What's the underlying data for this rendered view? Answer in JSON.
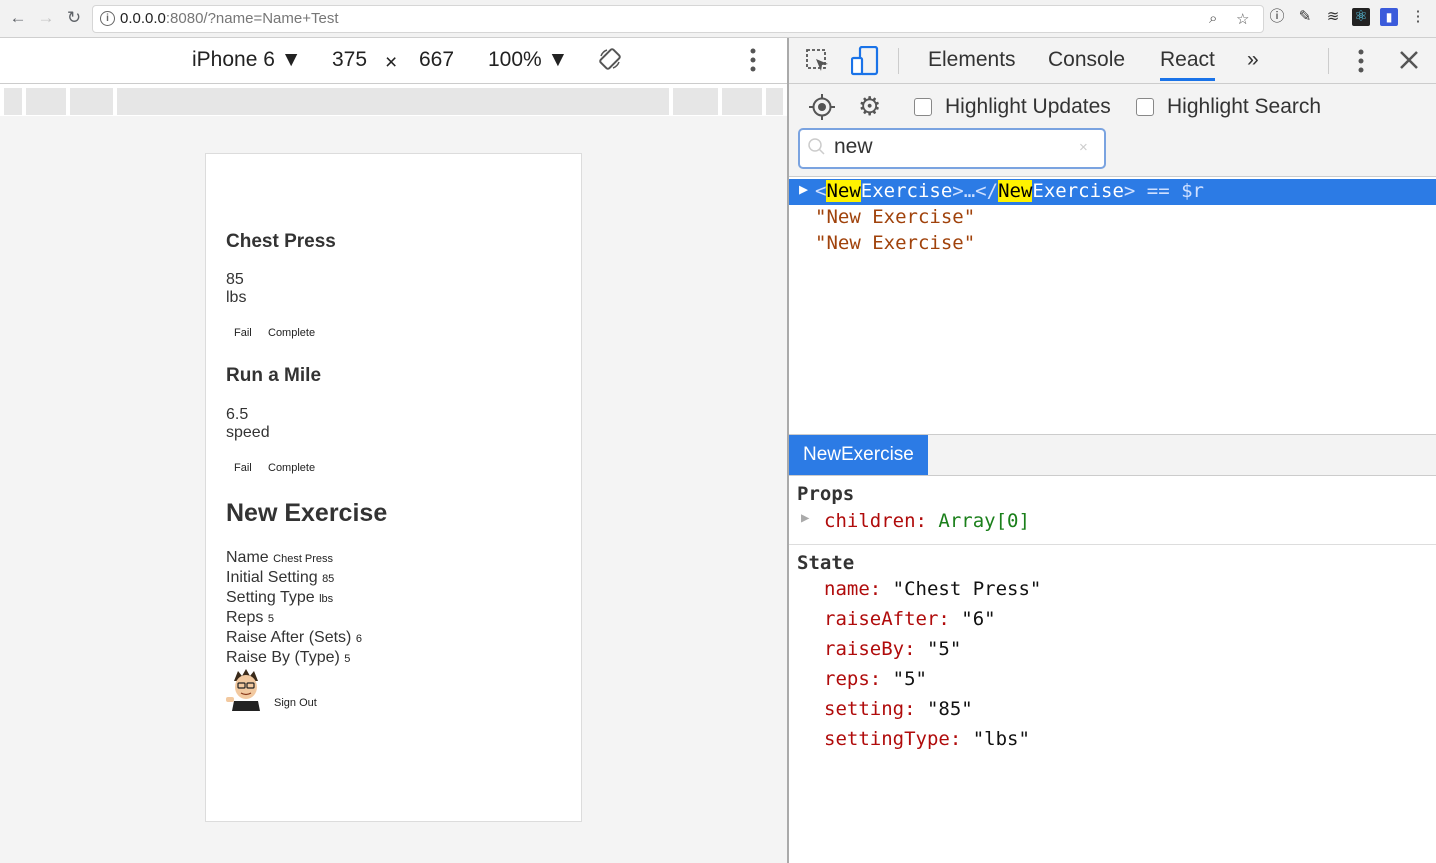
{
  "browser": {
    "url_host": "0.0.0.0",
    "url_path": ":8080/?name=Name+Test"
  },
  "device_toolbar": {
    "device": "iPhone 6 ▼",
    "width": "375",
    "times": "×",
    "height": "667",
    "zoom": "100% ▼"
  },
  "app": {
    "exercises": [
      {
        "title": "Chest Press",
        "value": "85",
        "unit": "lbs",
        "fail": "Fail",
        "complete": "Complete"
      },
      {
        "title": "Run a Mile",
        "value": "6.5",
        "unit": "speed",
        "fail": "Fail",
        "complete": "Complete"
      }
    ],
    "new_exercise": {
      "heading": "New Exercise",
      "fields": [
        {
          "label": "Name",
          "value": "Chest Press"
        },
        {
          "label": "Initial Setting",
          "value": "85"
        },
        {
          "label": "Setting Type",
          "value": "lbs"
        },
        {
          "label": "Reps",
          "value": "5"
        },
        {
          "label": "Raise After (Sets)",
          "value": "6"
        },
        {
          "label": "Raise By (Type)",
          "value": "5"
        }
      ]
    },
    "sign_out": "Sign Out"
  },
  "devtools": {
    "tabs": [
      "Elements",
      "Console",
      "React",
      "»"
    ],
    "active_tab": "React",
    "highlight_updates": "Highlight Updates",
    "highlight_search": "Highlight Search",
    "search_value": "new",
    "tree": {
      "selected": {
        "open_bracket": "<",
        "hl1": "New",
        "name1": "Exercise",
        "middle": ">…</",
        "hl2": "New",
        "name2": "Exercise",
        "close": "> == $r"
      },
      "children": [
        "\"New Exercise\"",
        "\"New Exercise\""
      ]
    },
    "component_tab": "NewExercise",
    "props_title": "Props",
    "props": [
      {
        "key": "children:",
        "value": "Array[0]"
      }
    ],
    "state_title": "State",
    "state": [
      {
        "key": "name:",
        "value": "\"Chest Press\""
      },
      {
        "key": "raiseAfter:",
        "value": "\"6\""
      },
      {
        "key": "raiseBy:",
        "value": "\"5\""
      },
      {
        "key": "reps:",
        "value": "\"5\""
      },
      {
        "key": "setting:",
        "value": "\"85\""
      },
      {
        "key": "settingType:",
        "value": "\"lbs\""
      }
    ]
  },
  "colors": {
    "selection": "#2c7be5",
    "highlight": "#fff200",
    "state_key": "#b00b0b",
    "string": "#a0420b"
  }
}
